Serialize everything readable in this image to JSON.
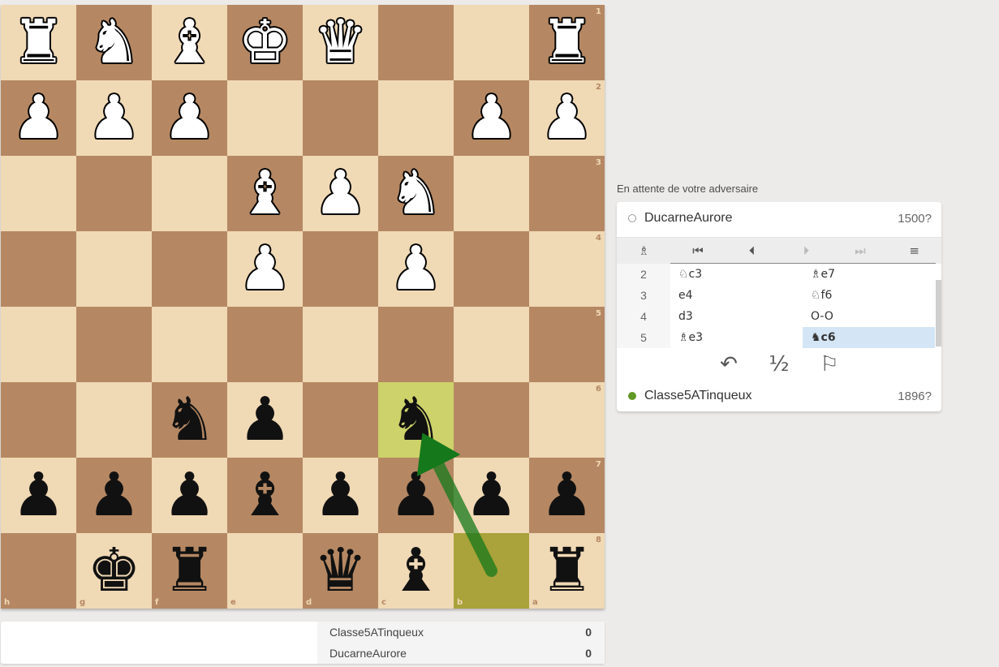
{
  "board": {
    "files_bottom": [
      "h",
      "g",
      "f",
      "e",
      "d",
      "c",
      "b",
      "a"
    ],
    "ranks_right": [
      "1",
      "2",
      "3",
      "4",
      "5",
      "6",
      "7",
      "8"
    ],
    "pieces": [
      {
        "sq": "h1",
        "glyph": "♜",
        "color": "w",
        "name": "white-rook-icon"
      },
      {
        "sq": "g1",
        "glyph": "♞",
        "color": "w",
        "name": "white-knight-icon"
      },
      {
        "sq": "f1",
        "glyph": "♝",
        "color": "w",
        "name": "white-bishop-icon"
      },
      {
        "sq": "e1",
        "glyph": "♚",
        "color": "w",
        "name": "white-king-icon"
      },
      {
        "sq": "d1",
        "glyph": "♛",
        "color": "w",
        "name": "white-queen-icon"
      },
      {
        "sq": "a1",
        "glyph": "♜",
        "color": "w",
        "name": "white-rook-icon"
      },
      {
        "sq": "h2",
        "glyph": "♟",
        "color": "w",
        "name": "white-pawn-icon"
      },
      {
        "sq": "g2",
        "glyph": "♟",
        "color": "w",
        "name": "white-pawn-icon"
      },
      {
        "sq": "f2",
        "glyph": "♟",
        "color": "w",
        "name": "white-pawn-icon"
      },
      {
        "sq": "b2",
        "glyph": "♟",
        "color": "w",
        "name": "white-pawn-icon"
      },
      {
        "sq": "a2",
        "glyph": "♟",
        "color": "w",
        "name": "white-pawn-icon"
      },
      {
        "sq": "e3",
        "glyph": "♝",
        "color": "w",
        "name": "white-bishop-icon"
      },
      {
        "sq": "d3",
        "glyph": "♟",
        "color": "w",
        "name": "white-pawn-icon"
      },
      {
        "sq": "c3",
        "glyph": "♞",
        "color": "w",
        "name": "white-knight-icon"
      },
      {
        "sq": "e4",
        "glyph": "♟",
        "color": "w",
        "name": "white-pawn-icon"
      },
      {
        "sq": "c4",
        "glyph": "♟",
        "color": "w",
        "name": "white-pawn-icon"
      },
      {
        "sq": "f6",
        "glyph": "♞",
        "color": "b",
        "name": "black-knight-icon"
      },
      {
        "sq": "e6",
        "glyph": "♟",
        "color": "b",
        "name": "black-pawn-icon"
      },
      {
        "sq": "c6",
        "glyph": "♞",
        "color": "b",
        "name": "black-knight-icon"
      },
      {
        "sq": "h7",
        "glyph": "♟",
        "color": "b",
        "name": "black-pawn-icon"
      },
      {
        "sq": "g7",
        "glyph": "♟",
        "color": "b",
        "name": "black-pawn-icon"
      },
      {
        "sq": "f7",
        "glyph": "♟",
        "color": "b",
        "name": "black-pawn-icon"
      },
      {
        "sq": "e7",
        "glyph": "♝",
        "color": "b",
        "name": "black-bishop-icon"
      },
      {
        "sq": "d7",
        "glyph": "♟",
        "color": "b",
        "name": "black-pawn-icon"
      },
      {
        "sq": "c7",
        "glyph": "♟",
        "color": "b",
        "name": "black-pawn-icon"
      },
      {
        "sq": "b7",
        "glyph": "♟",
        "color": "b",
        "name": "black-pawn-icon"
      },
      {
        "sq": "a7",
        "glyph": "♟",
        "color": "b",
        "name": "black-pawn-icon"
      },
      {
        "sq": "g8",
        "glyph": "♚",
        "color": "b",
        "name": "black-king-icon"
      },
      {
        "sq": "f8",
        "glyph": "♜",
        "color": "b",
        "name": "black-rook-icon"
      },
      {
        "sq": "d8",
        "glyph": "♛",
        "color": "b",
        "name": "black-queen-icon"
      },
      {
        "sq": "c8",
        "glyph": "♝",
        "color": "b",
        "name": "black-bishop-icon"
      },
      {
        "sq": "a8",
        "glyph": "♜",
        "color": "b",
        "name": "black-rook-icon"
      }
    ],
    "last_move": {
      "from": "b8",
      "to": "c6"
    },
    "arrow": {
      "from": "b8",
      "to": "c6",
      "color": "#15781b"
    }
  },
  "status_message": "En attente de votre adversaire",
  "player_top": {
    "name": "DucarneAurore",
    "rating": "1500?",
    "online": false
  },
  "player_bottom": {
    "name": "Classe5ATinqueux",
    "rating": "1896?",
    "online": true
  },
  "controls": [
    {
      "name": "analysis-icon",
      "glyph": "♗",
      "dim": false
    },
    {
      "name": "first-move-icon",
      "glyph": "⏮",
      "dim": false
    },
    {
      "name": "prev-move-icon",
      "glyph": "⏴",
      "dim": false
    },
    {
      "name": "next-move-icon",
      "glyph": "⏵",
      "dim": true
    },
    {
      "name": "last-move-icon",
      "glyph": "⏭",
      "dim": true
    },
    {
      "name": "menu-icon",
      "glyph": "≡",
      "dim": false
    }
  ],
  "moves": [
    {
      "num": "2",
      "white": "♘c3",
      "black": "♗e7"
    },
    {
      "num": "3",
      "white": "e4",
      "black": "♘f6"
    },
    {
      "num": "4",
      "white": "d3",
      "black": "O-O"
    },
    {
      "num": "5",
      "white": "♗e3",
      "black": "♞c6"
    }
  ],
  "active_move": "5b",
  "actions": [
    {
      "name": "takeback-icon",
      "glyph": "↶"
    },
    {
      "name": "draw-offer-icon",
      "glyph": "½"
    },
    {
      "name": "resign-flag-icon",
      "glyph": "⚐"
    }
  ],
  "scores": [
    {
      "name": "Classe5ATinqueux",
      "value": "0"
    },
    {
      "name": "DucarneAurore",
      "value": "0"
    }
  ],
  "colors": {
    "light": "#f0d9b5",
    "dark": "#b58863",
    "online": "#629924",
    "arrow": "#15781b"
  }
}
